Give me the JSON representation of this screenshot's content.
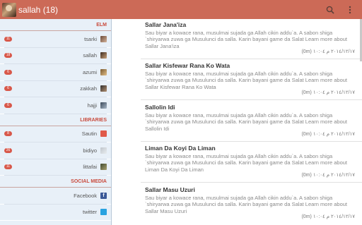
{
  "appbar": {
    "title": "sallah (18)",
    "search_icon": "search-icon",
    "overflow_icon": "overflow-menu-icon",
    "bar_color": "#cc6a57"
  },
  "drawer": {
    "sections": [
      {
        "header": "ELM",
        "items": [
          {
            "badge": "11",
            "label": "tsarki",
            "icon": "tsarki-thumbnail"
          },
          {
            "badge": "18",
            "label": "sallah",
            "icon": "sallah-thumbnail"
          },
          {
            "badge": "6",
            "label": "azumi",
            "icon": "azumi-thumbnail"
          },
          {
            "badge": "6",
            "label": "zakkah",
            "icon": "zakkah-thumbnail"
          },
          {
            "badge": "6",
            "label": "hajji",
            "icon": "hajji-thumbnail"
          }
        ]
      },
      {
        "header": "LIBRARIES",
        "items": [
          {
            "badge": "8",
            "label": "Sautin",
            "icon": "sautin-thumbnail"
          },
          {
            "badge": "26",
            "label": "bidiyo",
            "icon": "bidiyo-thumbnail"
          },
          {
            "badge": "11",
            "label": "littafai",
            "icon": "littafai-thumbnail"
          }
        ]
      },
      {
        "header": "SOCIAL MEDIA",
        "items": [
          {
            "label": "Facebook",
            "icon": "facebook-icon"
          },
          {
            "label": "twitter",
            "icon": "twitter-icon"
          }
        ]
      }
    ]
  },
  "entries": [
    {
      "title": "Sallar Jana'iza",
      "description": "Sau biyar a kowace rana, musulmai sujada ga Allah cikin addu`a. A sabon shiga `shiryarwa zuwa ga Musulunci da salla. Karin bayani game da Salat Learn more about Sallar Jana'iza",
      "date": "(0m) ٢٠١٤/١٢/١٧ م ١٠:٠٤"
    },
    {
      "title": "Sallar Kisfewar Rana Ko Wata",
      "description": "Sau biyar a kowace rana, musulmai sujada ga Allah cikin addu`a. A sabon shiga `shiryarwa zuwa ga Musulunci da salla. Karin bayani game da Salat Learn more about Sallar Kisfewar Rana Ko Wata",
      "date": "(0m) ٢٠١٤/١٢/١٧ م ١٠:٠٤"
    },
    {
      "title": "Sallolin Idi",
      "description": "Sau biyar a kowace rana, musulmai sujada ga Allah cikin addu`a. A sabon shiga `shiryarwa zuwa ga Musulunci da salla. Karin bayani game da Salat Learn more about Sallolin Idi",
      "date": "(0m) ٢٠١٤/١٢/١٧ م ١٠:٠٤"
    },
    {
      "title": "Liman Da Koyi Da Liman",
      "description": "Sau biyar a kowace rana, musulmai sujada ga Allah cikin addu`a. A sabon shiga `shiryarwa zuwa ga Musulunci da salla. Karin bayani game da Salat Learn more about Liman Da Koyi Da Liman",
      "date": "(0m) ٢٠١٤/١٢/١٧ م ١٠:٠٤"
    },
    {
      "title": "Sallar Masu Uzuri",
      "description": "Sau biyar a kowace rana, musulmai sujada ga Allah cikin addu`a. A sabon shiga `shiryarwa zuwa ga Musulunci da salla. Karin bayani game da Salat Learn more about Sallar Masu Uzuri",
      "date": "(0m) ٢٠١٤/١٢/١٧ م ١٠:٠٤"
    }
  ]
}
